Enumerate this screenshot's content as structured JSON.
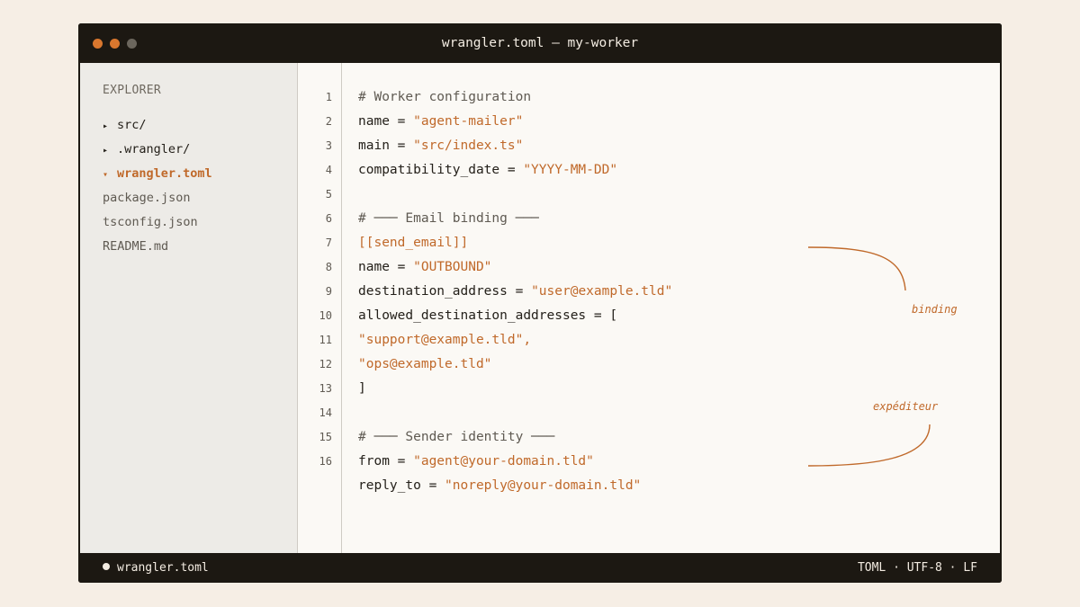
{
  "window": {
    "title": "wrangler.toml — my-worker",
    "controls": [
      {
        "name": "close",
        "color": "#d9772e"
      },
      {
        "name": "minimize",
        "color": "#d9772e"
      },
      {
        "name": "maximize",
        "color": "#6b665d"
      }
    ]
  },
  "sidebar": {
    "heading": "EXPLORER",
    "items": [
      {
        "label": "src/",
        "arrow": "▸",
        "kind": "dir"
      },
      {
        "label": ".wrangler/",
        "arrow": "▸",
        "kind": "dir"
      },
      {
        "label": "wrangler.toml",
        "arrow": "▾",
        "kind": "active"
      },
      {
        "label": "package.json",
        "arrow": "",
        "kind": "file"
      },
      {
        "label": "tsconfig.json",
        "arrow": "",
        "kind": "file"
      },
      {
        "label": "README.md",
        "arrow": "",
        "kind": "file"
      }
    ]
  },
  "editor": {
    "line_numbers": [
      "1",
      "2",
      "3",
      "4",
      "5",
      "6",
      "7",
      "8",
      "9",
      "10",
      "11",
      "12",
      "13",
      "14",
      "15",
      "16"
    ],
    "lines": [
      {
        "tokens": [
          {
            "t": "# Worker configuration",
            "c": "comment"
          }
        ]
      },
      {
        "tokens": [
          {
            "t": "name = ",
            "c": "plain"
          },
          {
            "t": "\"agent-mailer\"",
            "c": "string"
          }
        ]
      },
      {
        "tokens": [
          {
            "t": "main = ",
            "c": "plain"
          },
          {
            "t": "\"src/index.ts\"",
            "c": "string"
          }
        ]
      },
      {
        "tokens": [
          {
            "t": "compatibility_date = ",
            "c": "plain"
          },
          {
            "t": "\"YYYY-MM-DD\"",
            "c": "string"
          }
        ]
      },
      {
        "tokens": []
      },
      {
        "tokens": [
          {
            "t": "# ─── Email binding ───",
            "c": "comment"
          }
        ]
      },
      {
        "tokens": [
          {
            "t": "[[send_email]]",
            "c": "table"
          }
        ]
      },
      {
        "tokens": [
          {
            "t": "name = ",
            "c": "plain"
          },
          {
            "t": "\"OUTBOUND\"",
            "c": "string"
          }
        ]
      },
      {
        "tokens": [
          {
            "t": "destination_address = ",
            "c": "plain"
          },
          {
            "t": "\"user@example.tld\"",
            "c": "string"
          }
        ]
      },
      {
        "tokens": [
          {
            "t": "allowed_destination_addresses = [",
            "c": "plain"
          }
        ]
      },
      {
        "tokens": [
          {
            "t": "\"support@example.tld\",",
            "c": "string"
          }
        ]
      },
      {
        "tokens": [
          {
            "t": "\"ops@example.tld\"",
            "c": "string"
          }
        ]
      },
      {
        "tokens": [
          {
            "t": "]",
            "c": "plain"
          }
        ]
      },
      {
        "tokens": []
      },
      {
        "tokens": [
          {
            "t": "# ─── Sender identity ───",
            "c": "comment"
          }
        ]
      },
      {
        "tokens": [
          {
            "t": "from = ",
            "c": "plain"
          },
          {
            "t": "\"agent@your-domain.tld\"",
            "c": "string"
          }
        ]
      },
      {
        "tokens": [
          {
            "t": "reply_to = ",
            "c": "plain"
          },
          {
            "t": "\"noreply@your-domain.tld\"",
            "c": "string"
          }
        ]
      }
    ],
    "annotations": [
      {
        "label": "binding"
      },
      {
        "label": "expéditeur"
      }
    ]
  },
  "statusbar": {
    "filename": "wrangler.toml",
    "info": "TOML · UTF-8 · LF"
  },
  "colors": {
    "accent": "#c0692a",
    "chrome": "#1c1812",
    "background": "#f6eee5"
  }
}
